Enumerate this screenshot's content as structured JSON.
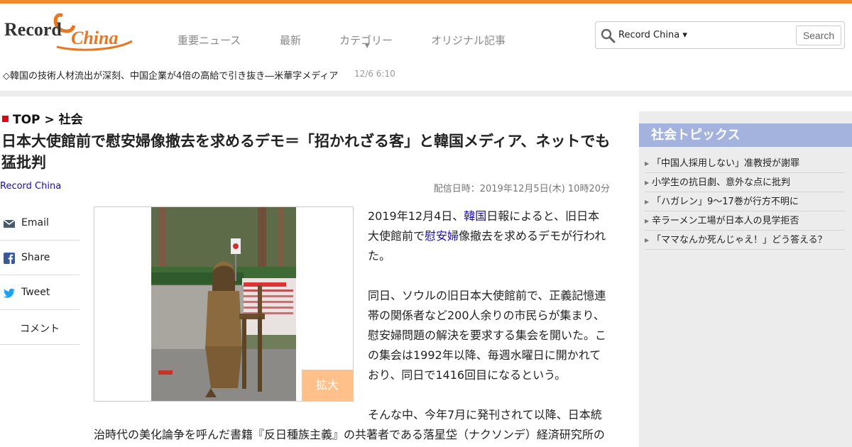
{
  "brand": {
    "logo_text_1": "Record",
    "logo_text_2": "China",
    "accent_color": "#f08a2c"
  },
  "nav": {
    "items": [
      {
        "label": "重要ニュース"
      },
      {
        "label": "最新"
      },
      {
        "label": "カテゴリー",
        "has_dropdown": true
      },
      {
        "label": "オリジナル記事"
      }
    ]
  },
  "search": {
    "scope": "Record China ▾",
    "button": "Search",
    "placeholder": ""
  },
  "ticker": {
    "headline": "◇韓国の技術人材流出が深刻、中国企業が4倍の高給で引き抜き―米華字メディア",
    "time": "12/6 6:10"
  },
  "breadcrumb": {
    "top": "TOP",
    "separator": ">",
    "category": "社会"
  },
  "article": {
    "title": "日本大使館前で慰安婦像撤去を求めるデモ＝「招かれざる客」と韓国メディア、ネットでも猛批判",
    "source": "Record China",
    "published": "配信日時：2019年12月5日(木) 10時20分",
    "p1_a": "2019年12月4日、",
    "p1_link1": "韓国",
    "p1_b": "日報によると、旧日本大使館前で",
    "p1_link2": "慰安婦",
    "p1_c": "像撤去を求めるデモが行われた。",
    "p2": "同日、ソウルの旧日本大使館前で、正義記憶連帯の関係者など200人余りの市民らが集まり、慰安婦問題の解決を要求する集会を開いた。この集会は1992年以降、毎週水曜日に開かれており、同日で1416回目になるという。",
    "p3_line1": "そんな中、今年7月に発刊されて以降、日本統",
    "p3_line2": "治時代の美化論争を呼んだ書籍『反日種族主義』の共著者である落星垈（ナクソンデ）経済研究所の",
    "enlarge": "拡大"
  },
  "share": [
    {
      "label": "Email",
      "icon": "email-icon"
    },
    {
      "label": "Share",
      "icon": "facebook-icon"
    },
    {
      "label": "Tweet",
      "icon": "twitter-icon"
    },
    {
      "label": "コメント",
      "icon": ""
    }
  ],
  "sidebar": {
    "heading": "社会トピックス",
    "items": [
      {
        "label": "「中国人採用しない」准教授が謝罪"
      },
      {
        "label": "小学生の抗日劇、意外な点に批判"
      },
      {
        "label": "「ハガレン」9～17巻が行方不明に"
      },
      {
        "label": "辛ラーメン工場が日本人の見学拒否"
      },
      {
        "label": "「ママなんか死んじゃえ！」どう答える？"
      }
    ]
  }
}
